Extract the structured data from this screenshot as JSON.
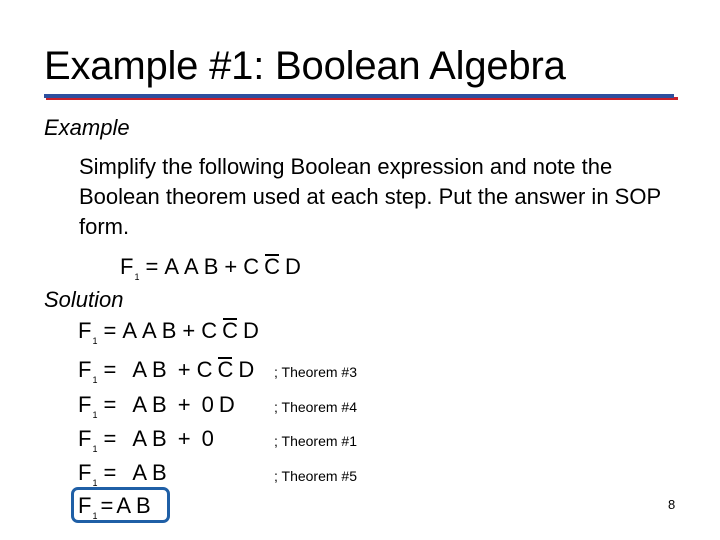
{
  "slide": {
    "title": "Example #1: Boolean Algebra",
    "example_label": "Example",
    "prompt": "Simplify the following Boolean expression and note the Boolean theorem used at each step. Put the answer in SOP form.",
    "given_expression": {
      "lhs": "F",
      "sub": "1",
      "eq": "=",
      "terms": [
        "A",
        "A",
        "B",
        "+",
        "C",
        "C̄",
        "D"
      ]
    },
    "solution_label": "Solution",
    "steps": [
      {
        "lhs": "F",
        "sub": "1",
        "eq": "=",
        "expr": [
          "A",
          "A",
          "B",
          "+",
          "C",
          "C̄",
          "D"
        ],
        "theorem": ""
      },
      {
        "lhs": "F",
        "sub": "1",
        "eq": "=",
        "expr": [
          "A",
          "B",
          "+",
          "C",
          "C̄",
          "D"
        ],
        "theorem": "; Theorem #3"
      },
      {
        "lhs": "F",
        "sub": "1",
        "eq": "=",
        "expr": [
          "A",
          "B",
          "+",
          "0",
          "D"
        ],
        "theorem": "; Theorem #4"
      },
      {
        "lhs": "F",
        "sub": "1",
        "eq": "=",
        "expr": [
          "A",
          "B",
          "+",
          "0"
        ],
        "theorem": "; Theorem #1"
      },
      {
        "lhs": "F",
        "sub": "1",
        "eq": "=",
        "expr": [
          "A",
          "B"
        ],
        "theorem": "; Theorem #5"
      }
    ],
    "final_answer": {
      "lhs": "F",
      "sub": "1",
      "eq": "=",
      "expr": [
        "A",
        "B"
      ]
    },
    "page_number": "8",
    "colors": {
      "rule_blue": "#2d4f9e",
      "rule_red": "#c8202a",
      "answer_box": "#1f5fa6"
    }
  }
}
